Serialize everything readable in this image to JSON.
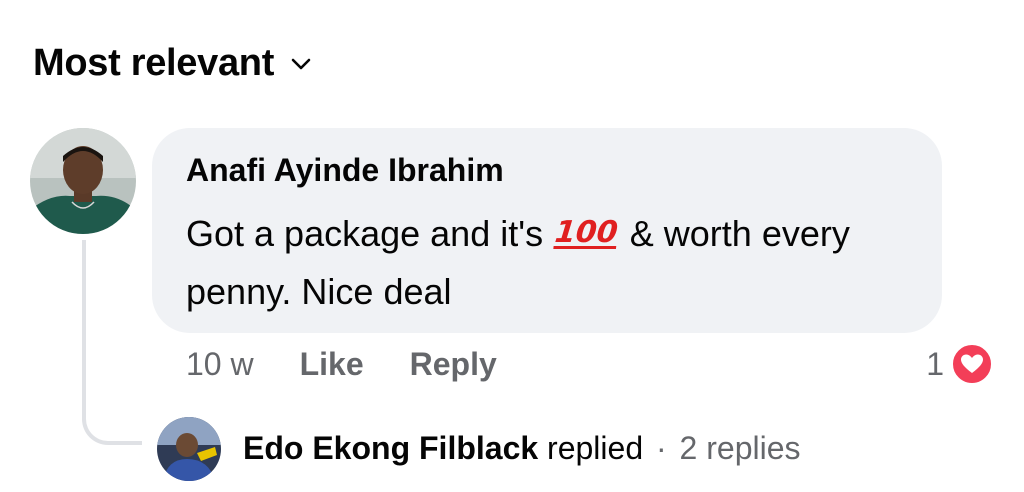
{
  "sort": {
    "label": "Most relevant",
    "icon": "chevron-down-icon"
  },
  "comment": {
    "author": "Anafi Ayinde Ibrahim",
    "text_before": "Got a package and it's",
    "emoji": "100",
    "text_after": "& worth every penny. Nice deal",
    "time": "10 w",
    "like_label": "Like",
    "reply_label": "Reply",
    "reaction_count": "1",
    "reaction_icon": "love-reaction-icon"
  },
  "reply_summary": {
    "name": "Edo Ekong Filblack",
    "verb": "replied",
    "separator": "·",
    "count": "2 replies"
  },
  "colors": {
    "bubble": "#f0f2f5",
    "secondary_text": "#65676b",
    "love_red": "#f33e58",
    "thread_line": "#dfe1e5"
  }
}
